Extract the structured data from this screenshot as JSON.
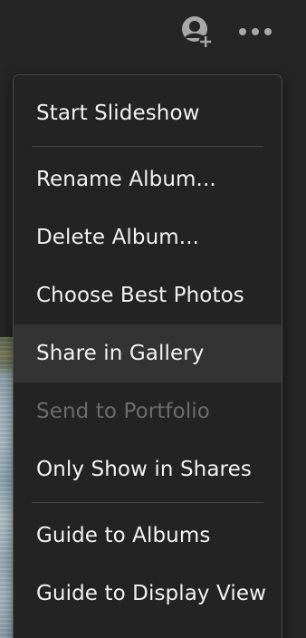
{
  "topbar": {
    "share_icon": "user-plus-icon",
    "more_icon": "ellipsis-icon"
  },
  "menu": {
    "groups": [
      {
        "items": [
          {
            "label": "Start Slideshow",
            "state": "normal"
          }
        ]
      },
      {
        "items": [
          {
            "label": "Rename Album...",
            "state": "normal"
          },
          {
            "label": "Delete Album...",
            "state": "normal"
          },
          {
            "label": "Choose Best Photos",
            "state": "normal"
          },
          {
            "label": "Share in Gallery",
            "state": "hover"
          },
          {
            "label": "Send to Portfolio",
            "state": "disabled"
          },
          {
            "label": "Only Show in Shares",
            "state": "normal"
          }
        ]
      },
      {
        "items": [
          {
            "label": "Guide to Albums",
            "state": "normal"
          },
          {
            "label": "Guide to Display View",
            "state": "normal"
          }
        ]
      }
    ]
  },
  "colors": {
    "background": "#252525",
    "menu_bg": "#232323",
    "hover_bg": "#333333",
    "text": "#f2f2f2",
    "disabled_text": "#6c6c6c",
    "icon": "#a8a8a8"
  }
}
